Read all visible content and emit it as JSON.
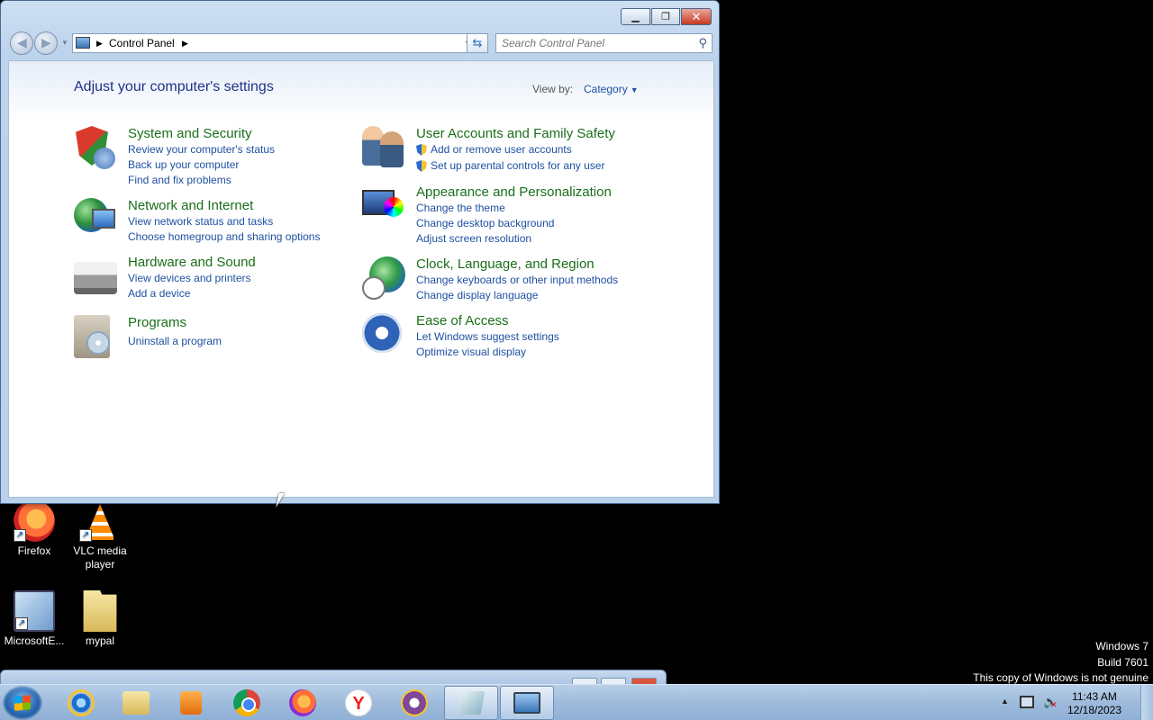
{
  "desktop": {
    "icons": [
      {
        "label": "Firefox"
      },
      {
        "label": "VLC media player"
      },
      {
        "label": "MicrosoftE..."
      },
      {
        "label": "mypal"
      }
    ],
    "watermark": [
      "Windows 7",
      "Build 7601",
      "This copy of Windows is not genuine"
    ]
  },
  "window": {
    "address": {
      "crumb": "Control Panel"
    },
    "search": {
      "placeholder": "Search Control Panel"
    },
    "page_title": "Adjust your computer's settings",
    "view_by": {
      "label": "View by:",
      "value": "Category"
    },
    "categories": [
      {
        "title": "System and Security",
        "links": [
          "Review your computer's status",
          "Back up your computer",
          "Find and fix problems"
        ]
      },
      {
        "title": "Network and Internet",
        "links": [
          "View network status and tasks",
          "Choose homegroup and sharing options"
        ]
      },
      {
        "title": "Hardware and Sound",
        "links": [
          "View devices and printers",
          "Add a device"
        ]
      },
      {
        "title": "Programs",
        "links": [
          "Uninstall a program"
        ]
      },
      {
        "title": "User Accounts and Family Safety",
        "links": [
          "Add or remove user accounts",
          "Set up parental controls for any user"
        ]
      },
      {
        "title": "Appearance and Personalization",
        "links": [
          "Change the theme",
          "Change desktop background",
          "Adjust screen resolution"
        ]
      },
      {
        "title": "Clock, Language, and Region",
        "links": [
          "Change keyboards or other input methods",
          "Change display language"
        ]
      },
      {
        "title": "Ease of Access",
        "links": [
          "Let Windows suggest settings",
          "Optimize visual display"
        ]
      }
    ]
  },
  "taskbar": {
    "clock": {
      "time": "11:43 AM",
      "date": "12/18/2023"
    }
  }
}
